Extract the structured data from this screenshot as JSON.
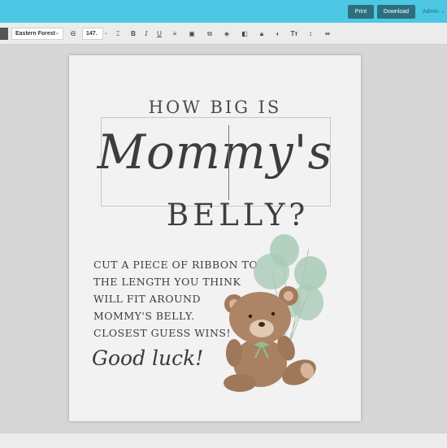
{
  "header": {
    "print_label": "Print",
    "download_label": "Download",
    "admin_label": "Admin"
  },
  "toolbar": {
    "font_family": "Eastern Forest",
    "font_size": "147."
  },
  "document": {
    "line1": "HOW BIG IS",
    "line2": "Mommy's",
    "line3": "BELLY?",
    "body_lines": [
      "CUT A PIECE OF RIBBON TO",
      "THE LENGTH YOU THINK",
      "WILL FIT AROUND",
      "MOMMY'S BELLY.",
      "CLOSEST GUESS WINS!"
    ],
    "signoff": "Good luck!"
  },
  "colors": {
    "header_bg": "#4dc8e4",
    "header_button": "#2d6f7e",
    "balloon_green": "#a9cbb7",
    "bear_brown": "#a37a5c"
  }
}
